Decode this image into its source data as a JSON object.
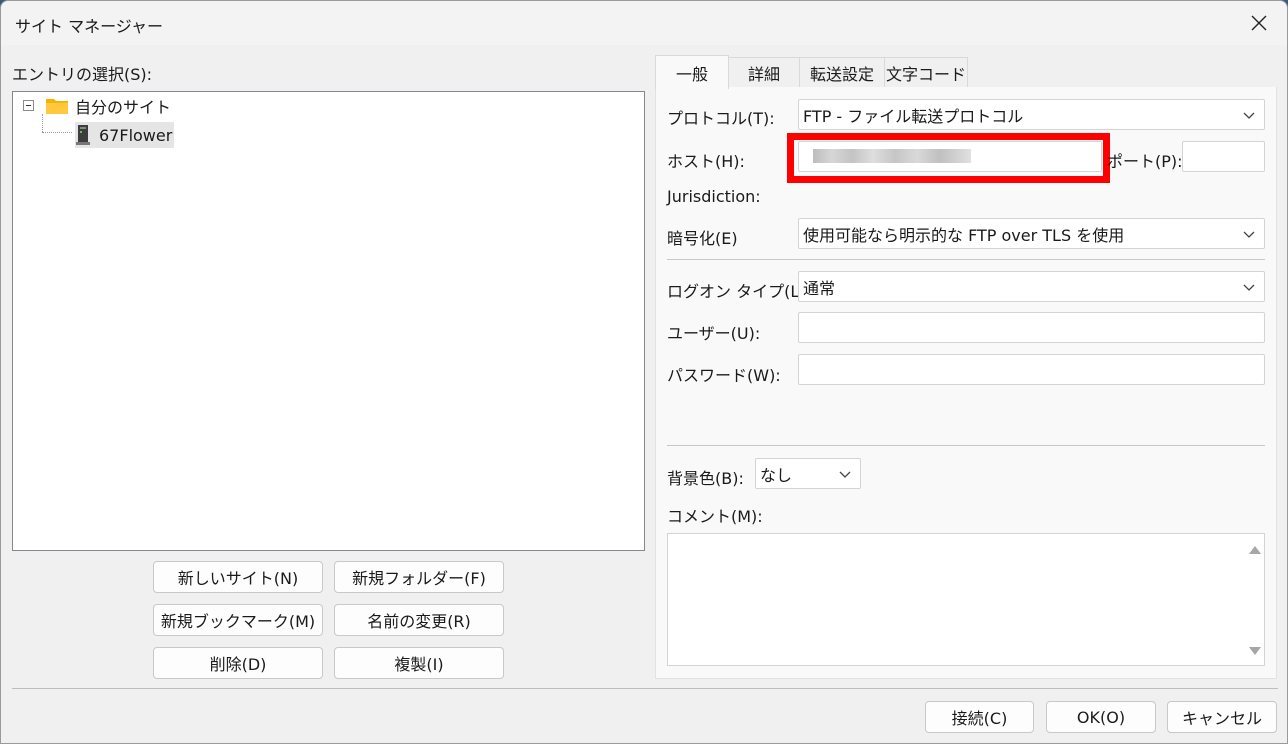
{
  "window": {
    "title": "サイト マネージャー"
  },
  "left": {
    "entry_label": "エントリの選択(S):",
    "tree": {
      "root": "自分のサイト",
      "child": "67Flower"
    },
    "buttons": {
      "new_site": "新しいサイト(N)",
      "new_folder": "新規フォルダー(F)",
      "new_bookmark": "新規ブックマーク(M)",
      "rename": "名前の変更(R)",
      "delete": "削除(D)",
      "duplicate": "複製(I)"
    }
  },
  "tabs": [
    "一般",
    "詳細",
    "転送設定",
    "文字コード"
  ],
  "general": {
    "protocol_label": "プロトコル(T):",
    "protocol_value": "FTP - ファイル転送プロトコル",
    "host_label": "ホスト(H):",
    "port_label": "ポート(P):",
    "jurisdiction_label": "Jurisdiction:",
    "encryption_label": "暗号化(E)",
    "encryption_value": "使用可能なら明示的な FTP over TLS を使用",
    "logon_type_label": "ログオン タイプ(L):",
    "logon_type_value": "通常",
    "user_label": "ユーザー(U):",
    "password_label": "パスワード(W):",
    "bgcolor_label": "背景色(B):",
    "bgcolor_value": "なし",
    "comment_label": "コメント(M):"
  },
  "footer": {
    "connect": "接続(C)",
    "ok": "OK(O)",
    "cancel": "キャンセル"
  },
  "colors": {
    "highlight_box": "#ff0000",
    "folder": "#f4b400"
  }
}
